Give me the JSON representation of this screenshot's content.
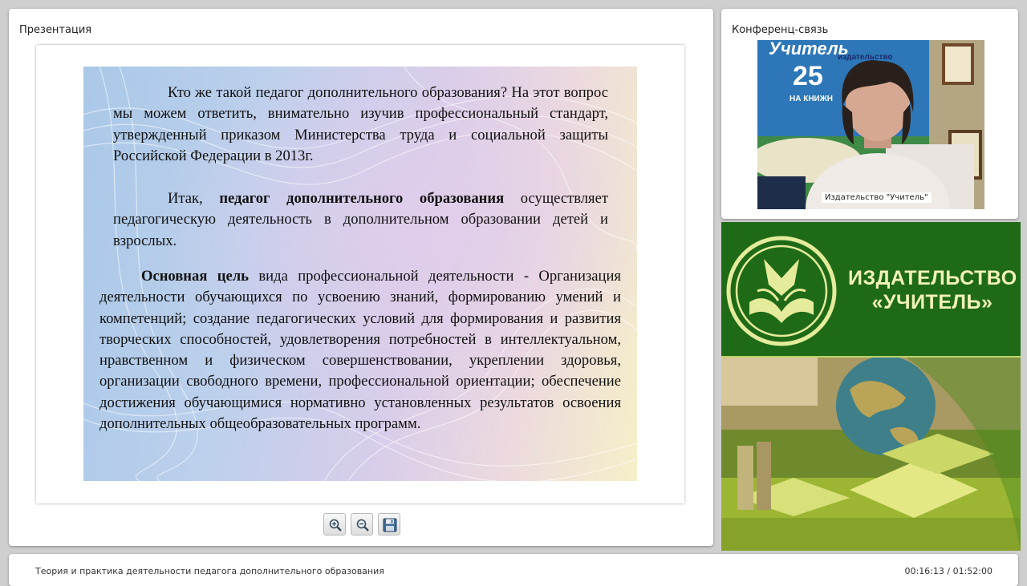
{
  "presentation": {
    "title": "Презентация",
    "slide": {
      "para1": "Кто же такой педагог дополнительного образования? На этот вопрос мы можем ответить, внимательно изучив профессиональный стандарт, утвержденный приказом Министерства труда и социальной защиты Российской Федерации в 2013г.",
      "para2_lead": "Итак,",
      "para2_bold": "педагог дополнительного образования",
      "para2_rest": "осуществляет педагогическую деятельность в дополнительном образовании детей и взрослых.",
      "para3_bold": "Основная цель",
      "para3_rest": "вида профессиональной деятельности - Организация деятельности обучающихся по усвоению знаний, формированию умений и компетенций; создание педагогических условий для формирования и развития творческих способностей, удовлетворения потребностей в интеллектуальном, нравственном и физическом совершенствовании, укреплении здоровья, организации свободного времени, профессиональной ориентации; обеспечение достижения обучающимися нормативно установленных результатов освоения дополнительных общеобразовательных программ."
    },
    "toolbar": {
      "zoom_in_icon": "zoom-in-icon",
      "zoom_out_icon": "zoom-out-icon",
      "save_icon": "floppy-disk-icon"
    }
  },
  "conference": {
    "title": "Конференц-связь",
    "speaker_label": "Издательство \"Учитель\"",
    "poster_text_top": "Учитель",
    "poster_text_sub": "издательство",
    "poster_text_years": "25",
    "poster_text_bottom": "НА КНИЖН"
  },
  "logo": {
    "line1": "ИЗДАТЕЛЬСТВО",
    "line2": "«УЧИТЕЛЬ»",
    "colors": {
      "band": "#1f6a17",
      "text": "#f1f3b8"
    }
  },
  "footer": {
    "course_title": "Теория и практика деятельности педагога дополнительного образования",
    "timecode": "00:16:13 / 01:52:00"
  }
}
